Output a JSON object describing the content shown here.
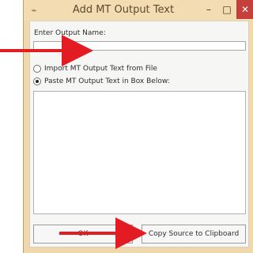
{
  "window": {
    "title": "Add MT Output Text",
    "app_icon": "pin-icon",
    "controls": {
      "minimize": "–",
      "maximize": "□",
      "close": "✕"
    }
  },
  "form": {
    "output_name_label": "Enter Output Name:",
    "output_name_value": "",
    "import_option_label": "Import MT Output Text from File",
    "paste_option_label": "Paste MT Output Text in Box Below:",
    "selected_option": "paste",
    "text_value": ""
  },
  "buttons": {
    "ok_label": "OK",
    "copy_label": "Copy Source to Clipboard"
  },
  "colors": {
    "arrow": "#e31b23",
    "title_accent": "#f4dcb2",
    "close_button": "#c5403c"
  }
}
